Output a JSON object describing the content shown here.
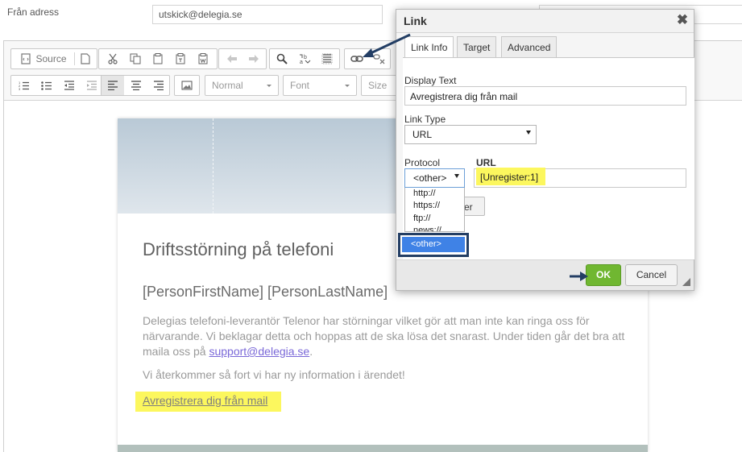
{
  "form": {
    "from_label": "Från adress",
    "from_value": "utskick@delegia.se"
  },
  "toolbar": {
    "source_label": "Source",
    "format_combo": "Normal",
    "font_combo": "Font",
    "size_combo": "Size"
  },
  "email": {
    "title": "Driftsstörning på telefoni",
    "name_line": "[PersonFirstName] [PersonLastName]",
    "body_text": "Delegias telefoni-leverantör Telenor har störningar vilket gör att man inte kan ringa oss för närvarande. Vi beklagar detta och hoppas att de ska lösa det snarast. Under tiden går det bra att maila oss på ",
    "body_link": "support@delegia.se",
    "body_end": ".",
    "body_text2": "Vi återkommer så fort vi har ny information i ärendet!",
    "unsubscribe_link": "Avregistrera dig från mail"
  },
  "dialog": {
    "title": "Link",
    "close_symbol": "✖",
    "tabs": [
      {
        "label": "Link Info",
        "active": true
      },
      {
        "label": "Target",
        "active": false
      },
      {
        "label": "Advanced",
        "active": false
      }
    ],
    "display_text_label": "Display Text",
    "display_text_value": "Avregistrera dig från mail",
    "link_type_label": "Link Type",
    "link_type_value": "URL",
    "protocol_label": "Protocol",
    "protocol_value": "<other>",
    "protocol_options": [
      "http://",
      "https://",
      "ftp://",
      "news://",
      "<other>"
    ],
    "url_label": "URL",
    "url_value": "[Unregister:1]",
    "browse_label": "ver",
    "ok_label": "OK",
    "cancel_label": "Cancel"
  },
  "colors": {
    "highlight": "#fcf75e",
    "ok_button": "#70b731",
    "selected_option": "#3f82e6",
    "annotation_arrow": "#233e64"
  }
}
